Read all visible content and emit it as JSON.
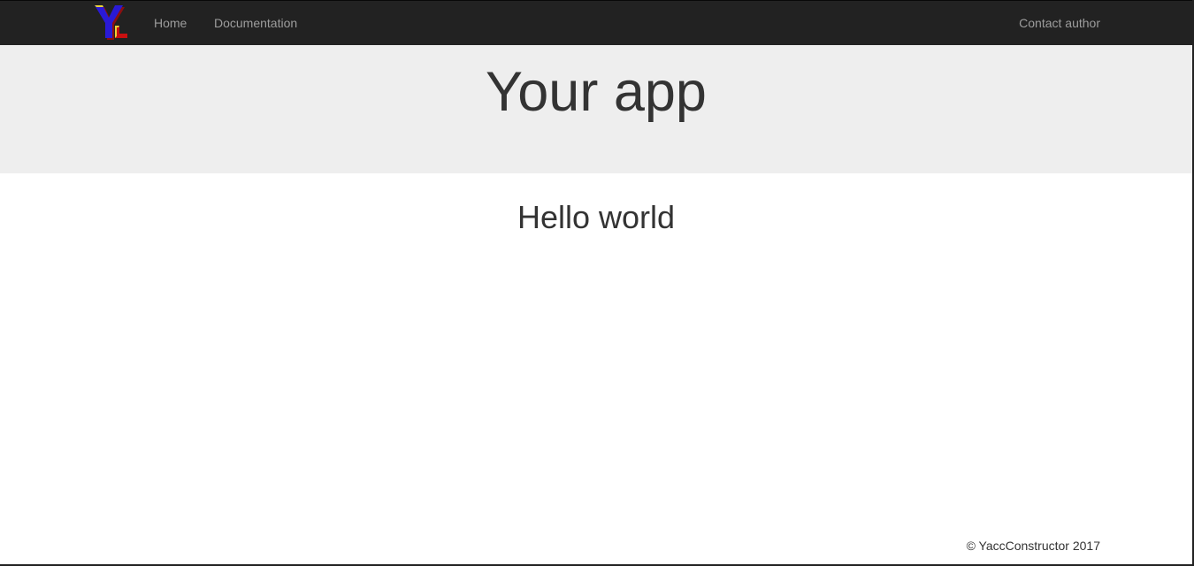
{
  "navbar": {
    "logo_text": "YC",
    "links": {
      "home": "Home",
      "documentation": "Documentation",
      "contact": "Contact author"
    }
  },
  "jumbotron": {
    "title": "Your app"
  },
  "main": {
    "heading": "Hello world"
  },
  "footer": {
    "copyright": "© YaccConstructor 2017"
  },
  "colors": {
    "navbar_bg": "#222222",
    "nav_link": "#9d9d9d",
    "jumbotron_bg": "#eeeeee",
    "text": "#333333",
    "logo_blue": "#2a1ad6",
    "logo_red": "#c81010",
    "logo_yellow": "#e8d23a"
  }
}
